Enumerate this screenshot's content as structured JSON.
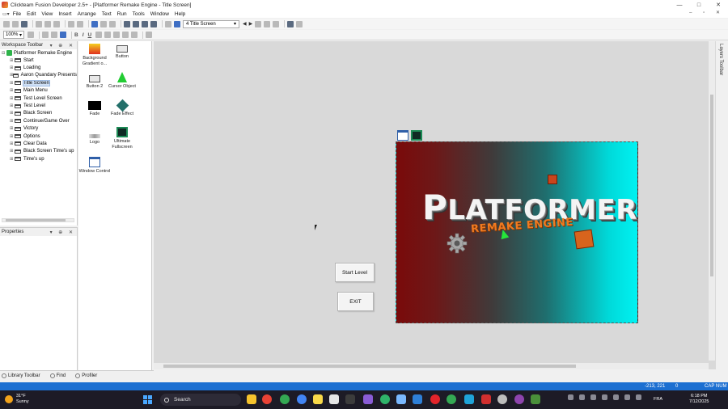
{
  "window": {
    "title": "Clickteam Fusion Developer 2.5+ - [Platformer Remake Engine - Title Screen]",
    "minimize_glyph": "—",
    "maximize_glyph": "□",
    "close_glyph": "✕"
  },
  "menubar": {
    "items": [
      "File",
      "Edit",
      "View",
      "Insert",
      "Arrange",
      "Text",
      "Run",
      "Tools",
      "Window",
      "Help"
    ],
    "mdi_controls": "– ▫ ✕"
  },
  "toolbar": {
    "frame_selector": "4 Title Screen",
    "zoom": "100%",
    "bold": "B",
    "italic": "I",
    "underline": "U"
  },
  "workspace": {
    "title": "Workspace Toolbar",
    "controls": "▾ ⊕ ✕",
    "root": "Platformer Remake Engine",
    "frames": [
      "Start",
      "Loading",
      "Aaron Quandary Presents",
      "Title Screen",
      "Main Menu",
      "Test Level Screen",
      "Test Level",
      "Black Screen",
      "Continue/Game Over",
      "Victory",
      "Options",
      "Clear Data",
      "Black Screen Time's up",
      "Time's up"
    ],
    "selected": "Title Screen"
  },
  "properties": {
    "title": "Properties",
    "controls": "▾ ⊕ ✕"
  },
  "objects": [
    {
      "label": "Background Gradient o...",
      "icon": "gradient-icon"
    },
    {
      "label": "Button",
      "icon": "button-icon"
    },
    {
      "label": "Button 2",
      "icon": "button-icon"
    },
    {
      "label": "Cursor Object",
      "icon": "cursor-object-icon"
    },
    {
      "label": "Fade",
      "icon": "fade-icon"
    },
    {
      "label": "Fade Effect",
      "icon": "fade-effect-icon"
    },
    {
      "label": "Logo",
      "icon": "logo-icon"
    },
    {
      "label": "Ultimate Fullscreen",
      "icon": "fullscreen-icon"
    },
    {
      "label": "Window Control",
      "icon": "window-control-icon"
    }
  ],
  "bottom_tabs": [
    "Library Toolbar",
    "Find",
    "Profiler"
  ],
  "layers_toolbar_label": "Layers Toolbar",
  "canvas": {
    "logo_text_first": "P",
    "logo_text_rest": "LATFORMER",
    "logo_subtitle": "REMAKE ENGINE",
    "button_start": "Start Level",
    "button_exit": "EXIT",
    "gradient_colors": [
      "#7a0a0a",
      "#00f2f2"
    ]
  },
  "statusbar": {
    "coords": "-213, 221",
    "layer": "0",
    "indicators": "CAP NUM"
  },
  "taskbar": {
    "weather_temp": "31°F",
    "weather_desc": "Sunny",
    "search_label": "Search",
    "lang": "FRA",
    "time": "6:18 PM",
    "date": "7/12/2025"
  }
}
